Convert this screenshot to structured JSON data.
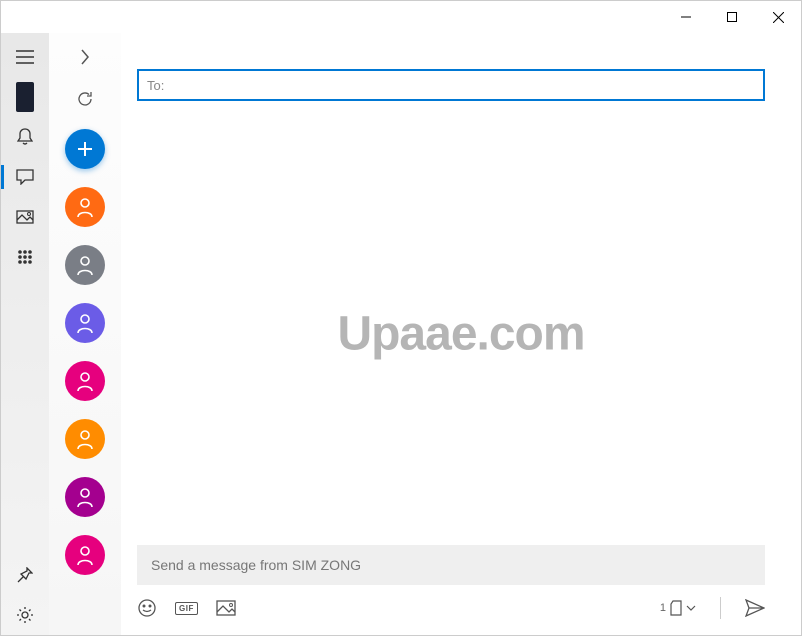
{
  "to_placeholder": "To:",
  "message_placeholder": "Send a message from SIM ZONG",
  "watermark": "Upaae.com",
  "sim_number": "1",
  "gif_label": "GIF",
  "contacts": [
    {
      "color": "#ff6a13"
    },
    {
      "color": "#7a7e86"
    },
    {
      "color": "#6b5ce7"
    },
    {
      "color": "#e6007e"
    },
    {
      "color": "#ff8c00"
    },
    {
      "color": "#a4008f"
    },
    {
      "color": "#e6007e"
    }
  ]
}
